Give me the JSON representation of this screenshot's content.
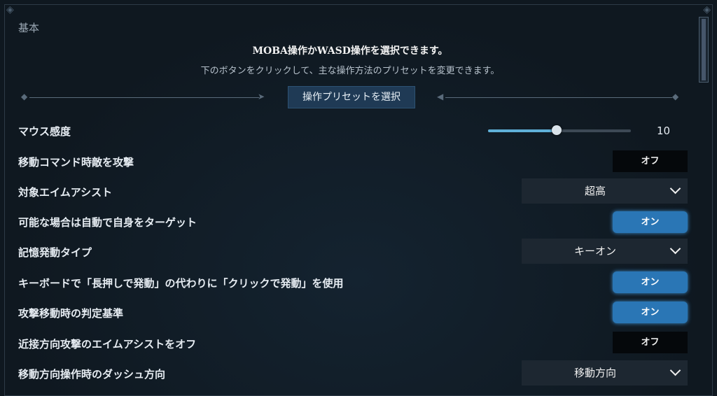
{
  "section": {
    "title": "基本"
  },
  "header": {
    "heading": "MOBA操作かWASD操作を選択できます。",
    "subheading": "下のボタンをクリックして、主な操作方法のプリセットを変更できます。",
    "preset_button": "操作プリセットを選択"
  },
  "settings": {
    "mouse_sensitivity": {
      "label": "マウス感度",
      "value": "10",
      "fraction": 0.48
    },
    "move_command_attack": {
      "label": "移動コマンド時敵を攻撃",
      "toggle": "オフ"
    },
    "target_aim_assist": {
      "label": "対象エイムアシスト",
      "value": "超高"
    },
    "auto_self_target": {
      "label": "可能な場合は自動で自身をターゲット",
      "toggle": "オン"
    },
    "memory_trigger_type": {
      "label": "記憶発動タイプ",
      "value": "キーオン"
    },
    "click_instead_of_hold": {
      "label": "キーボードで「長押しで発動」の代わりに「クリックで発動」を使用",
      "toggle": "オン"
    },
    "attack_move_criteria": {
      "label": "攻撃移動時の判定基準",
      "toggle": "オン"
    },
    "melee_aim_assist_off": {
      "label": "近接方向攻撃のエイムアシストをオフ",
      "toggle": "オフ"
    },
    "dash_direction": {
      "label": "移動方向操作時のダッシュ方向",
      "value": "移動方向"
    }
  },
  "colors": {
    "accent": "#2a76b5",
    "slider_fill": "#5fb0d8",
    "background": "#0f1820"
  }
}
